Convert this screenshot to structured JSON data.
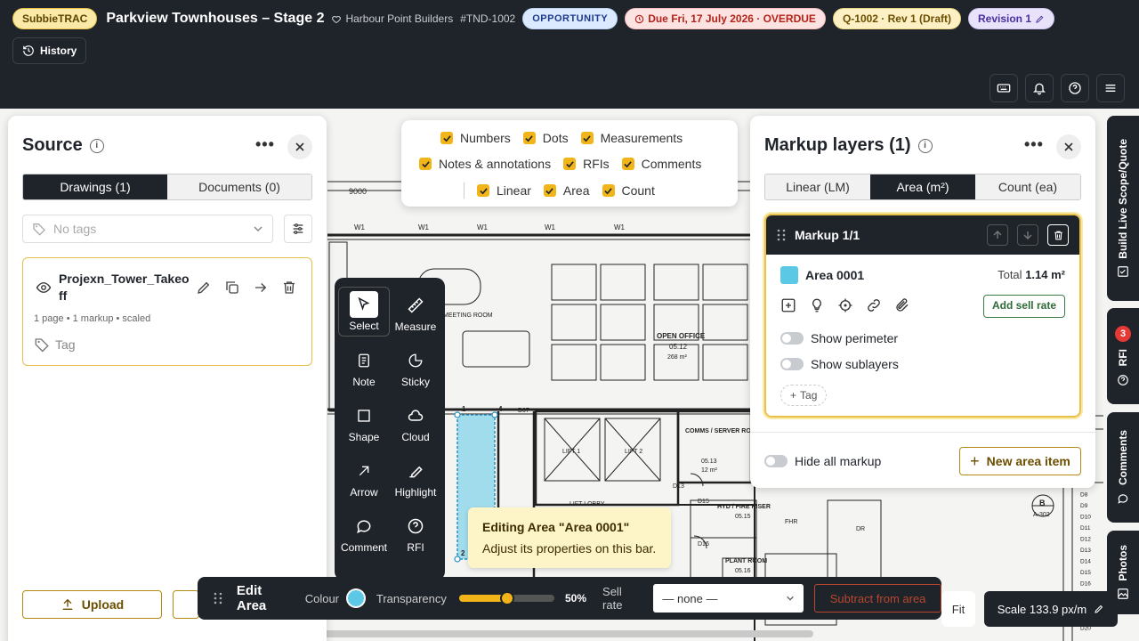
{
  "header": {
    "brand": "SubbieTRAC",
    "project_title": "Parkview Townhouses – Stage 2",
    "client": "Harbour Point Builders",
    "ref": "#TND-1002",
    "status": "OPPORTUNITY",
    "due": "Due Fri, 17 July 2026 · OVERDUE",
    "quote": "Q-1002 · Rev 1 (Draft)",
    "revision": "Revision 1",
    "history_label": "History",
    "icons": [
      "keyboard-icon",
      "bell-icon",
      "help-icon",
      "menu-icon"
    ]
  },
  "source_panel": {
    "title": "Source",
    "tabs": [
      "Drawings (1)",
      "Documents (0)"
    ],
    "active_tab": "Drawings (1)",
    "tags_placeholder": "No tags",
    "file": {
      "name": "Projexn_Tower_Takeoff",
      "meta": "1 page • 1 markup • scaled",
      "tag_label": "Tag"
    },
    "upload_label": "Upload"
  },
  "layer_filter": {
    "row1": [
      "Numbers",
      "Dots",
      "Measurements"
    ],
    "row2": [
      "Notes & annotations",
      "RFIs",
      "Comments"
    ],
    "row3": [
      "Linear",
      "Area",
      "Count"
    ]
  },
  "tools": [
    {
      "label": "Select",
      "icon": "cursor-icon",
      "selected": true
    },
    {
      "label": "Measure",
      "icon": "ruler-icon"
    },
    {
      "label": "Note",
      "icon": "note-icon"
    },
    {
      "label": "Sticky",
      "icon": "sticky-icon"
    },
    {
      "label": "Shape",
      "icon": "square-icon"
    },
    {
      "label": "Cloud",
      "icon": "cloud-icon"
    },
    {
      "label": "Arrow",
      "icon": "arrow-icon"
    },
    {
      "label": "Highlight",
      "icon": "highlighter-icon"
    },
    {
      "label": "Comment",
      "icon": "comment-icon"
    },
    {
      "label": "RFI",
      "icon": "question-icon"
    }
  ],
  "tooltip": {
    "title": "Editing Area \"Area 0001\"",
    "body": "Adjust its properties on this bar."
  },
  "edit_bar": {
    "title": "Edit Area",
    "colour_label": "Colour",
    "colour": "#5bc8e6",
    "transparency_label": "Transparency",
    "transparency": 50,
    "transparency_text": "50%",
    "sell_rate_label": "Sell rate",
    "sell_rate_value": "— none —",
    "subtract_label": "Subtract from area"
  },
  "markup_panel": {
    "title": "Markup layers (1)",
    "tabs": [
      "Linear (LM)",
      "Area (m²)",
      "Count (ea)"
    ],
    "active_tab": "Area (m²)",
    "markup_header": "Markup 1/1",
    "area_name": "Area 0001",
    "total_label": "Total",
    "total_value": "1.14 m²",
    "add_sell_rate": "Add sell rate",
    "show_perimeter": "Show perimeter",
    "show_sublayers": "Show sublayers",
    "tag_label": "Tag",
    "hide_all": "Hide all markup",
    "new_area": "New area item"
  },
  "right_rail": {
    "build_live": "Build Live Scope/Quote",
    "rfi": "RFI",
    "rfi_count": "3",
    "comments": "Comments",
    "photos": "Photos"
  },
  "plan_labels": {
    "dim": "9000",
    "open_office": "OPEN OFFICE",
    "open_office_no": "05.12",
    "open_office_area": "268 m²",
    "lift1": "LIFT 1",
    "lift2": "LIFT 2",
    "comms": "COMMS / SERVER ROOM",
    "comms_no": "05.13",
    "comms_area": "12 m²",
    "hyd": "HYD / FIRE RISER",
    "hyd_no": "05.15",
    "plant": "PLANT ROOM",
    "plant_no": "05.16",
    "lift_lobby": "LIFT LOBBY",
    "fhr": "FHR",
    "dr": "DR",
    "meeting": "MEETING ROOM",
    "door_d07": "D07",
    "door_d13": "D13",
    "door_d15": "D15",
    "door_d16": "D16",
    "section_b": "B",
    "section_ref": "A-302",
    "vertex_1": "1",
    "vertex_2": "2",
    "vertex_4": "4",
    "w_tag": "W1",
    "d_tags": [
      "D1",
      "D2",
      "D3",
      "D4",
      "D5",
      "D6",
      "D7",
      "D8",
      "D9",
      "D10",
      "D11",
      "D12",
      "D13",
      "D14",
      "D15",
      "D16",
      "D17",
      "D18",
      "D19",
      "D20"
    ]
  },
  "scale": {
    "fit_label": "Fit",
    "scale_text": "Scale 133.9 px/m"
  }
}
